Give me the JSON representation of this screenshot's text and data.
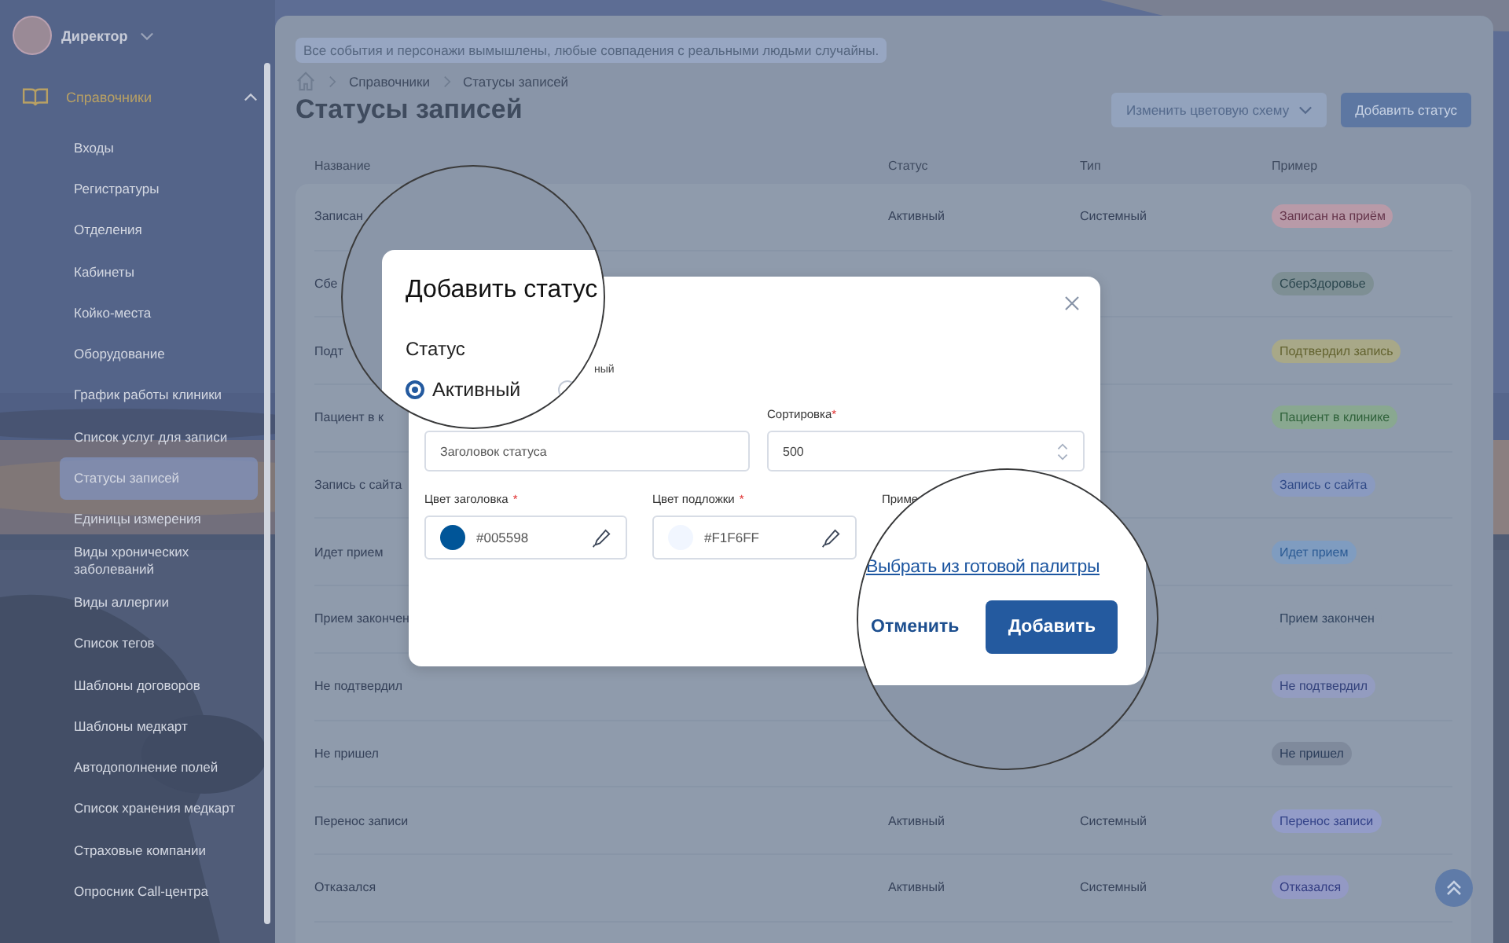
{
  "sidebar": {
    "user": {
      "name": "Директор"
    },
    "groups": [
      {
        "label": "Справочники",
        "expanded": true,
        "children": [
          {
            "label": "Входы",
            "selected": false
          },
          {
            "label": "Регистратуры",
            "selected": false
          },
          {
            "label": "Отделения",
            "selected": false
          },
          {
            "label": "Кабинеты",
            "selected": false
          },
          {
            "label": "Койко-места",
            "selected": false
          },
          {
            "label": "Оборудование",
            "selected": false
          },
          {
            "label": "График работы клиники",
            "selected": false
          },
          {
            "label": "Список услуг для записи",
            "selected": false
          },
          {
            "label": "Статусы записей",
            "selected": true
          },
          {
            "label": "Единицы измерения",
            "selected": false
          },
          {
            "label": "Виды хронических заболеваний",
            "selected": false
          },
          {
            "label": "Виды аллергии",
            "selected": false
          },
          {
            "label": "Список тегов",
            "selected": false
          },
          {
            "label": "Шаблоны договоров",
            "selected": false
          },
          {
            "label": "Шаблоны медкарт",
            "selected": false
          },
          {
            "label": "Автодополнение полей",
            "selected": false
          },
          {
            "label": "Список хранения медкарт",
            "selected": false
          },
          {
            "label": "Страховые компании",
            "selected": false
          },
          {
            "label": "Опросник Call-центра",
            "selected": false
          }
        ]
      }
    ]
  },
  "notice": "Все события и персонажи вымышлены, любые совпадения с реальными людьми случайны.",
  "breadcrumbs": [
    "Справочники",
    "Статусы записей"
  ],
  "page_title": "Статусы записей",
  "header_buttons": [
    {
      "label": "Изменить цветовую схему",
      "kind": "dropdown"
    },
    {
      "label": "Добавить статус",
      "kind": "primary"
    }
  ],
  "table": {
    "columns": [
      "Название",
      "Статус",
      "Тип",
      "Пример"
    ],
    "rows": [
      {
        "name": "Записан",
        "status": "Активный",
        "type": "Системный",
        "example": {
          "label": "Записан на приём",
          "color": "#b89aa8"
        }
      },
      {
        "name": "Сбе",
        "example": {
          "label": "СберЗдоровье",
          "color": "#7e8f94"
        }
      },
      {
        "name": "Подт",
        "example": {
          "label": "Подтвердил запись",
          "color": "#a8a888"
        }
      },
      {
        "name": "Пациент в к",
        "example": {
          "label": "Пациент в клинике",
          "color": "#89a890"
        }
      },
      {
        "name": "Запись с сайта",
        "example": {
          "label": "Запись с сайта",
          "color": "#8a9ac0"
        }
      },
      {
        "name": "Идет прием",
        "example": {
          "label": "Идет прием",
          "color": "#7f9cc0"
        }
      },
      {
        "name": "Прием закончен",
        "example": {
          "label": "Прием закончен",
          "color": "#8f9bac"
        }
      },
      {
        "name": "Не подтвердил",
        "example": {
          "label": "Не подтвердил",
          "color": "#939cc0"
        }
      },
      {
        "name": "Не пришел",
        "example": {
          "label": "Не пришел",
          "color": "#7f8a9c"
        }
      },
      {
        "name": "Перенос записи",
        "status": "Активный",
        "type": "Системный",
        "example": {
          "label": "Перенос записи",
          "color": "#939cc8"
        }
      },
      {
        "name": "Отказался",
        "status": "Активный",
        "type": "Системный",
        "example": {
          "label": "Отказался",
          "color": "#9399c4"
        }
      }
    ]
  },
  "dialog": {
    "option_label_tail": "ный",
    "title_placeholder": "Заголовок статуса",
    "sort": {
      "label": "Сортировка",
      "required_mark": "*",
      "value": "500"
    },
    "colors": [
      {
        "label": "Цвет заголовка",
        "required_mark": "*",
        "value": "#005598",
        "color": "#005598"
      },
      {
        "label": "Цвет подложки",
        "required_mark": "*",
        "value": "#F1F6FF",
        "color": "#f1f6ff"
      }
    ],
    "example_label": "Приме"
  },
  "magnifiers": [
    {
      "title": "Добавить статус",
      "status_label": "Статус",
      "options": [
        {
          "label": "Активный",
          "selected": true
        },
        {
          "selected": false
        }
      ]
    },
    {
      "link": "Выбрать из готовой палитры",
      "buttons": [
        {
          "label": "Отменить",
          "kind": "text"
        },
        {
          "label": "Добавить",
          "kind": "primary"
        }
      ]
    }
  ]
}
